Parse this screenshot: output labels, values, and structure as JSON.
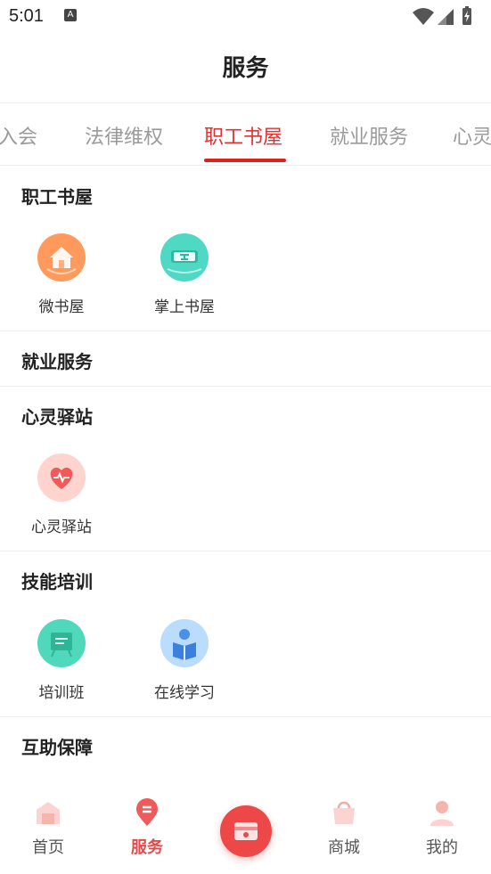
{
  "status": {
    "time": "5:01",
    "notification_badge": "A"
  },
  "header": {
    "title": "服务"
  },
  "tabs": [
    {
      "label": "入会"
    },
    {
      "label": "法律维权"
    },
    {
      "label": "职工书屋",
      "active": true
    },
    {
      "label": "就业服务"
    },
    {
      "label": "心灵"
    }
  ],
  "sections": [
    {
      "title": "职工书屋",
      "items": [
        {
          "label": "微书屋",
          "icon": "house-icon"
        },
        {
          "label": "掌上书屋",
          "icon": "book-icon"
        }
      ]
    },
    {
      "title": "就业服务",
      "items": []
    },
    {
      "title": "心灵驿站",
      "items": [
        {
          "label": "心灵驿站",
          "icon": "heart-icon"
        }
      ]
    },
    {
      "title": "技能培训",
      "items": [
        {
          "label": "培训班",
          "icon": "board-icon"
        },
        {
          "label": "在线学习",
          "icon": "reader-icon"
        }
      ]
    },
    {
      "title": "互助保障",
      "items": []
    }
  ],
  "tabbar": [
    {
      "label": "首页",
      "icon": "home-icon"
    },
    {
      "label": "服务",
      "icon": "service-icon",
      "active": true
    },
    {
      "label": "",
      "icon": "card-icon"
    },
    {
      "label": "商城",
      "icon": "bag-icon"
    },
    {
      "label": "我的",
      "icon": "user-icon"
    }
  ],
  "colors": {
    "accent": "#e03232",
    "tab_active_bar": "#e01e1e",
    "center_button": "#ee4747"
  }
}
